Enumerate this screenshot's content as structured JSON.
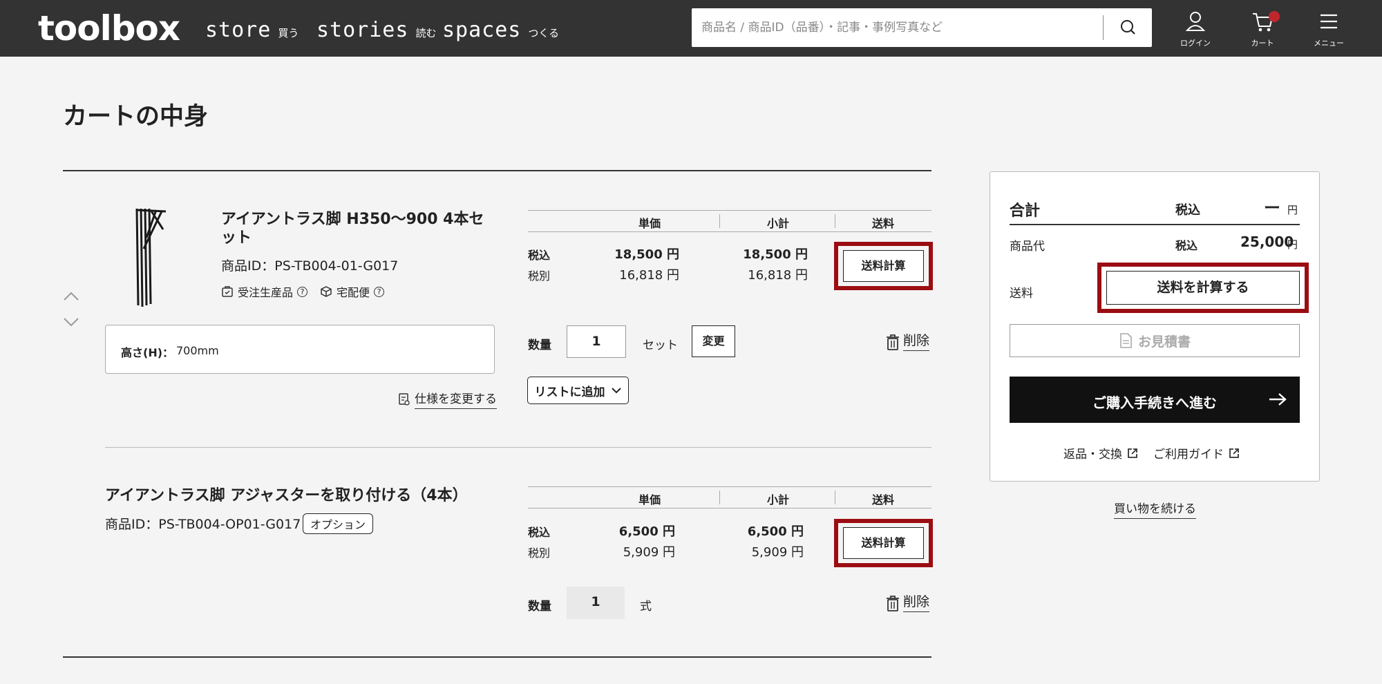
{
  "header": {
    "logo": "toolbox",
    "nav": [
      {
        "en": "store",
        "ja": "買う"
      },
      {
        "en": "stories",
        "ja": "読む"
      },
      {
        "en": "spaces",
        "ja": "つくる"
      }
    ],
    "search_placeholder": "商品名 / 商品ID（品番）・記事・事例写真など",
    "login_label": "ログイン",
    "cart_label": "カート",
    "menu_label": "メニュー"
  },
  "page": {
    "title": "カートの中身"
  },
  "table_headers": {
    "unit_price": "単価",
    "subtotal": "小計",
    "shipping": "送料"
  },
  "labels": {
    "tax_in": "税込",
    "tax_ex": "税別",
    "quantity": "数量",
    "change": "変更",
    "delete": "削除",
    "add_to_list": "リストに追加",
    "ship_calc": "送料計算",
    "change_spec": "仕様を変更する"
  },
  "items": [
    {
      "name": "アイアントラス脚 H350〜900 4本セット",
      "product_id": "商品ID：PS-TB004-01-G017",
      "badge_made_to_order": "受注生産品",
      "badge_delivery": "宅配便",
      "spec_key": "高さ(H)：",
      "spec_value": "700mm",
      "unit_price_in": "18,500 円",
      "unit_price_ex": "16,818 円",
      "subtotal_in": "18,500 円",
      "subtotal_ex": "16,818 円",
      "quantity": "1",
      "unit": "セット"
    },
    {
      "name": "アイアントラス脚 アジャスターを取り付ける（4本）",
      "product_id": "商品ID：PS-TB004-OP01-G017",
      "badge_option": "オプション",
      "unit_price_in": "6,500 円",
      "unit_price_ex": "5,909 円",
      "subtotal_in": "6,500 円",
      "subtotal_ex": "5,909 円",
      "quantity": "1",
      "unit": "式"
    }
  ],
  "summary": {
    "total_label": "合計",
    "tax_label": "税込",
    "total_value": "ー",
    "yen": "円",
    "goods_label": "商品代",
    "goods_value": "25,000",
    "shipping_label": "送料",
    "calc_shipping_button": "送料を計算する",
    "quote_button": "お見積書",
    "checkout_button": "ご購入手続きへ進む",
    "returns_link": "返品・交換",
    "guide_link": "ご利用ガイド",
    "continue_shopping": "買い物を続ける"
  },
  "colors": {
    "header_bg": "#333333",
    "highlight": "#9b0d12",
    "cart_badge": "#c0272d"
  }
}
